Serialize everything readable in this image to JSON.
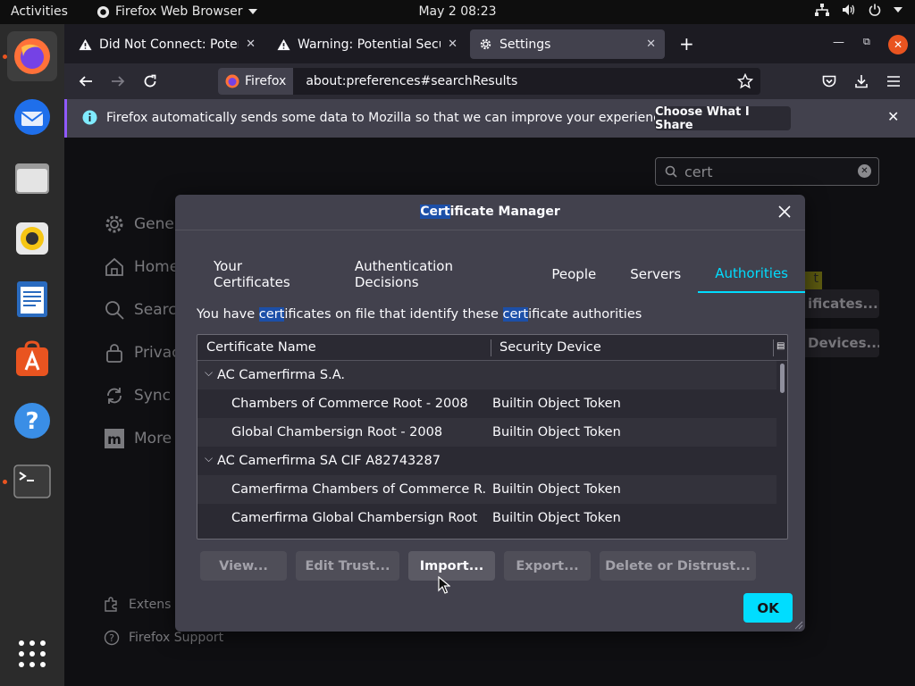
{
  "topbar": {
    "activities": "Activities",
    "app_name": "Firefox Web Browser",
    "clock": "May 2  08:23"
  },
  "tabs": [
    {
      "title": "Did Not Connect: Potenti",
      "icon": "warning-icon"
    },
    {
      "title": "Warning: Potential Secur",
      "icon": "warning-icon"
    },
    {
      "title": "Settings",
      "icon": "gear-icon"
    }
  ],
  "navbar": {
    "identity_label": "Firefox",
    "url": "about:preferences#searchResults"
  },
  "notification": {
    "text": "Firefox automatically sends some data to Mozilla so that we can improve your experience.",
    "button_label": "Choose What I Share"
  },
  "settings": {
    "search_value": "cert",
    "sidebar": [
      {
        "label": "Gene",
        "icon": "gear-icon"
      },
      {
        "label": "Home",
        "icon": "home-icon"
      },
      {
        "label": "Searc",
        "icon": "search-icon"
      },
      {
        "label": "Privac",
        "icon": "lock-icon"
      },
      {
        "label": "Sync",
        "icon": "sync-icon"
      },
      {
        "label": "More",
        "icon": "mozilla-icon"
      }
    ],
    "footer": [
      {
        "label": "Extens",
        "icon": "puzzle-icon"
      },
      {
        "label": "Firefox Support",
        "icon": "help-icon"
      }
    ],
    "bg_button_1": "ificates...",
    "bg_button_2": "Devices...",
    "bg_highlight": "t"
  },
  "dialog": {
    "title_hl": "Cert",
    "title_rest": "ificate Manager",
    "tabs": [
      "Your Certificates",
      "Authentication Decisions",
      "People",
      "Servers",
      "Authorities"
    ],
    "selected_tab": "Authorities",
    "desc_1": "You have ",
    "desc_hl_1": "cert",
    "desc_2": "ificates on file that identify these ",
    "desc_hl_2": "cert",
    "desc_3": "ificate authorities",
    "columns": [
      "Certificate Name",
      "Security Device"
    ],
    "rows": [
      {
        "name": "AC Camerfirma S.A.",
        "device": "",
        "group": true
      },
      {
        "name": "Chambers of Commerce Root - 2008",
        "device": "Builtin Object Token",
        "group": false
      },
      {
        "name": "Global Chambersign Root - 2008",
        "device": "Builtin Object Token",
        "group": false
      },
      {
        "name": "AC Camerfirma SA CIF A82743287",
        "device": "",
        "group": true
      },
      {
        "name": "Camerfirma Chambers of Commerce R...",
        "device": "Builtin Object Token",
        "group": false
      },
      {
        "name": "Camerfirma Global Chambersign Root",
        "device": "Builtin Object Token",
        "group": false
      }
    ],
    "buttons": {
      "view": "View...",
      "edit_trust": "Edit Trust...",
      "import": "Import...",
      "export": "Export...",
      "delete": "Delete or Distrust...",
      "ok": "OK"
    }
  },
  "colors": {
    "accent": "#00ddff",
    "highlight": "#1c4fa8",
    "dialog_bg": "#42414d",
    "ubuntu_orange": "#e95420"
  }
}
